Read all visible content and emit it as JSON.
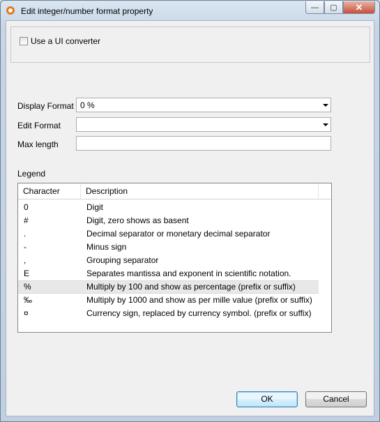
{
  "window": {
    "title": "Edit integer/number format property",
    "controls": {
      "minimize": "—",
      "maximize": "▢",
      "close": "✕"
    }
  },
  "converter": {
    "label": "Use a UI converter",
    "checked": false
  },
  "form": {
    "display_format_label": "Display Format",
    "display_format_value": "0 %",
    "edit_format_label": "Edit Format",
    "edit_format_value": "",
    "max_length_label": "Max length",
    "max_length_value": ""
  },
  "legend": {
    "title": "Legend",
    "columns": [
      "Character",
      "Description"
    ],
    "rows": [
      {
        "char": "0",
        "desc": "Digit"
      },
      {
        "char": "#",
        "desc": "Digit, zero shows as basent"
      },
      {
        "char": ".",
        "desc": "Decimal separator or monetary decimal separator"
      },
      {
        "char": "-",
        "desc": "Minus sign"
      },
      {
        "char": ",",
        "desc": "Grouping separator"
      },
      {
        "char": "E",
        "desc": "Separates mantissa and exponent in scientific notation."
      },
      {
        "char": "%",
        "desc": "Multiply by 100 and show as percentage (prefix or suffix)"
      },
      {
        "char": "‰",
        "desc": "Multiply by 1000 and show as per mille value (prefix or suffix)"
      },
      {
        "char": "¤",
        "desc": "Currency sign, replaced by currency symbol. (prefix or suffix)"
      }
    ],
    "selected_index": 6
  },
  "buttons": {
    "ok": "OK",
    "cancel": "Cancel"
  }
}
